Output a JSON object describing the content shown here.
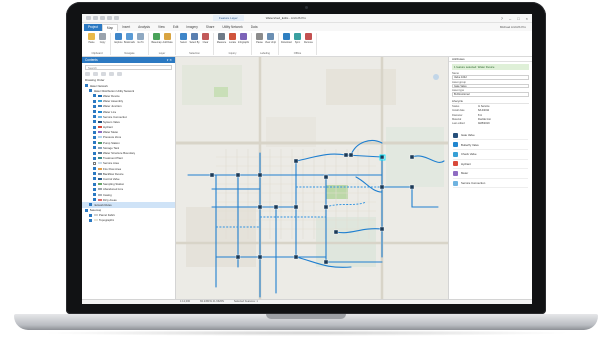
{
  "app": {
    "window_title": "Watershed_Edits - ArcGIS Pro",
    "context_tab": "Feature Layer",
    "signin": "Michael  ArcGIS Pro"
  },
  "ribbon": {
    "tabs": [
      {
        "label": "Project",
        "kind": "project"
      },
      {
        "label": "Map",
        "kind": "active"
      },
      {
        "label": "Insert",
        "kind": ""
      },
      {
        "label": "Analysis",
        "kind": ""
      },
      {
        "label": "View",
        "kind": ""
      },
      {
        "label": "Edit",
        "kind": ""
      },
      {
        "label": "Imagery",
        "kind": ""
      },
      {
        "label": "Share",
        "kind": ""
      },
      {
        "label": "Utility Network",
        "kind": ""
      },
      {
        "label": "Data",
        "kind": ""
      }
    ],
    "groups": [
      {
        "label": "Clipboard",
        "buttons": [
          {
            "label": "Paste",
            "color": "#e9b949"
          },
          {
            "label": "Copy",
            "color": "#9aa3ad"
          }
        ]
      },
      {
        "label": "Navigate",
        "buttons": [
          {
            "label": "Explore",
            "color": "#3f86c9"
          },
          {
            "label": "Bookmarks",
            "color": "#5a9bd5"
          },
          {
            "label": "Go To",
            "color": "#8fa9c2"
          }
        ]
      },
      {
        "label": "Layer",
        "buttons": [
          {
            "label": "Basemap",
            "color": "#4aa35a"
          },
          {
            "label": "Add Data",
            "color": "#d9a441"
          }
        ]
      },
      {
        "label": "Selection",
        "buttons": [
          {
            "label": "Select",
            "color": "#3f86c9"
          },
          {
            "label": "Select By",
            "color": "#5a7fb0"
          },
          {
            "label": "Clear",
            "color": "#c25a5a"
          }
        ]
      },
      {
        "label": "Inquiry",
        "buttons": [
          {
            "label": "Measure",
            "color": "#6f7b88"
          },
          {
            "label": "Locate",
            "color": "#d0543c"
          },
          {
            "label": "Infographics",
            "color": "#7c63b8"
          }
        ]
      },
      {
        "label": "Labeling",
        "buttons": [
          {
            "label": "Pause",
            "color": "#8c8c8c"
          },
          {
            "label": "View Unplaced",
            "color": "#6b8fb3"
          }
        ]
      },
      {
        "label": "Offline",
        "buttons": [
          {
            "label": "Download Map",
            "color": "#2f7fc1"
          },
          {
            "label": "Sync",
            "color": "#3aa0a0"
          },
          {
            "label": "Remove",
            "color": "#c35050"
          }
        ]
      }
    ]
  },
  "contents": {
    "title": "Contents",
    "search_placeholder": "Search",
    "section_label": "Drawing Order",
    "rows": [
      {
        "label": "Water Network",
        "indent": 0,
        "on": true,
        "color": ""
      },
      {
        "label": "Water Distribution Utility Network",
        "indent": 1,
        "on": true,
        "color": ""
      },
      {
        "label": "Water Device",
        "indent": 2,
        "on": true,
        "color": "#1f6fb3"
      },
      {
        "label": "Water Assembly",
        "indent": 2,
        "on": true,
        "color": "#37a0d6"
      },
      {
        "label": "Water Junction",
        "indent": 2,
        "on": true,
        "color": "#3d7fb7"
      },
      {
        "label": "Water Line",
        "indent": 2,
        "on": true,
        "color": "#2186cf"
      },
      {
        "label": "Service Connection",
        "indent": 2,
        "on": true,
        "color": "#6fb3e0"
      },
      {
        "label": "System Valve",
        "indent": 2,
        "on": true,
        "color": "#264f7a"
      },
      {
        "label": "Hydrant",
        "indent": 2,
        "on": true,
        "color": "#d94a3a"
      },
      {
        "label": "Water Meter",
        "indent": 2,
        "on": true,
        "color": "#8f6cc2"
      },
      {
        "label": "Pressure Zone",
        "indent": 2,
        "on": true,
        "color": "#b2d3ea"
      },
      {
        "label": "Pump Station",
        "indent": 2,
        "on": true,
        "color": "#4f9a6a"
      },
      {
        "label": "Storage Tank",
        "indent": 2,
        "on": true,
        "color": "#8aa3bb"
      },
      {
        "label": "Water Structure Boundary",
        "indent": 2,
        "on": true,
        "color": "#5b7c99"
      },
      {
        "label": "Treatment Plant",
        "indent": 2,
        "on": true,
        "color": "#3a8a8a"
      },
      {
        "label": "Service Area",
        "indent": 2,
        "on": false,
        "color": "#c9dbe9"
      },
      {
        "label": "Fire Flow Area",
        "indent": 2,
        "on": true,
        "color": "#e4a04a"
      },
      {
        "label": "Backflow Device",
        "indent": 2,
        "on": true,
        "color": "#7a8fa3"
      },
      {
        "label": "Control Valve",
        "indent": 2,
        "on": true,
        "color": "#2a5d8f"
      },
      {
        "label": "Sampling Station",
        "indent": 2,
        "on": true,
        "color": "#6aa56a"
      },
      {
        "label": "Abandoned Line",
        "indent": 2,
        "on": true,
        "color": "#9fa6ad"
      },
      {
        "label": "Casing",
        "indent": 2,
        "on": true,
        "color": "#b0b5ba"
      },
      {
        "label": "Dirty Areas",
        "indent": 2,
        "on": true,
        "color": "#e07070"
      },
      {
        "label": "Network Rules",
        "indent": 1,
        "on": true,
        "color": ""
      },
      {
        "label": "Basemap",
        "indent": 0,
        "on": true,
        "color": ""
      },
      {
        "label": "Parcel Fabric",
        "indent": 1,
        "on": true,
        "color": "#cfcfcf"
      },
      {
        "label": "Topographic",
        "indent": 1,
        "on": true,
        "color": "#e8e4d6"
      }
    ],
    "selected_index": 23
  },
  "attributes": {
    "header": "Attributes",
    "banner": "1 feature selected: Water Device",
    "fields": [
      {
        "label": "Name",
        "value": "Valve 1042"
      },
      {
        "label": "Asset group",
        "value": "Gate Valve"
      },
      {
        "label": "Asset type",
        "value": "Bi-Directional"
      }
    ],
    "section": "Lifecycle",
    "pairs": [
      {
        "k": "Status",
        "v": "In Service"
      },
      {
        "k": "Install date",
        "v": "6/14/2011"
      },
      {
        "k": "Diameter",
        "v": "8 in"
      },
      {
        "k": "Material",
        "v": "Ductile Iron"
      },
      {
        "k": "Last edited",
        "v": "9/28/2019"
      }
    ],
    "list": [
      {
        "label": "Gate Valve",
        "color": "#264f7a"
      },
      {
        "label": "Butterfly Valve",
        "color": "#2186cf"
      },
      {
        "label": "Check Valve",
        "color": "#37a0d6"
      },
      {
        "label": "Hydrant",
        "color": "#d94a3a"
      },
      {
        "label": "Meter",
        "color": "#8f6cc2"
      },
      {
        "label": "Service Connection",
        "color": "#6fb3e0"
      }
    ]
  },
  "status": {
    "scale": "1:12,000",
    "coords": "84.2451W 41.6620N",
    "selected": "Selected Features: 1"
  },
  "colors": {
    "accent": "#2b79c2",
    "network": "#1f7fd0",
    "device": "#1b3a57"
  }
}
